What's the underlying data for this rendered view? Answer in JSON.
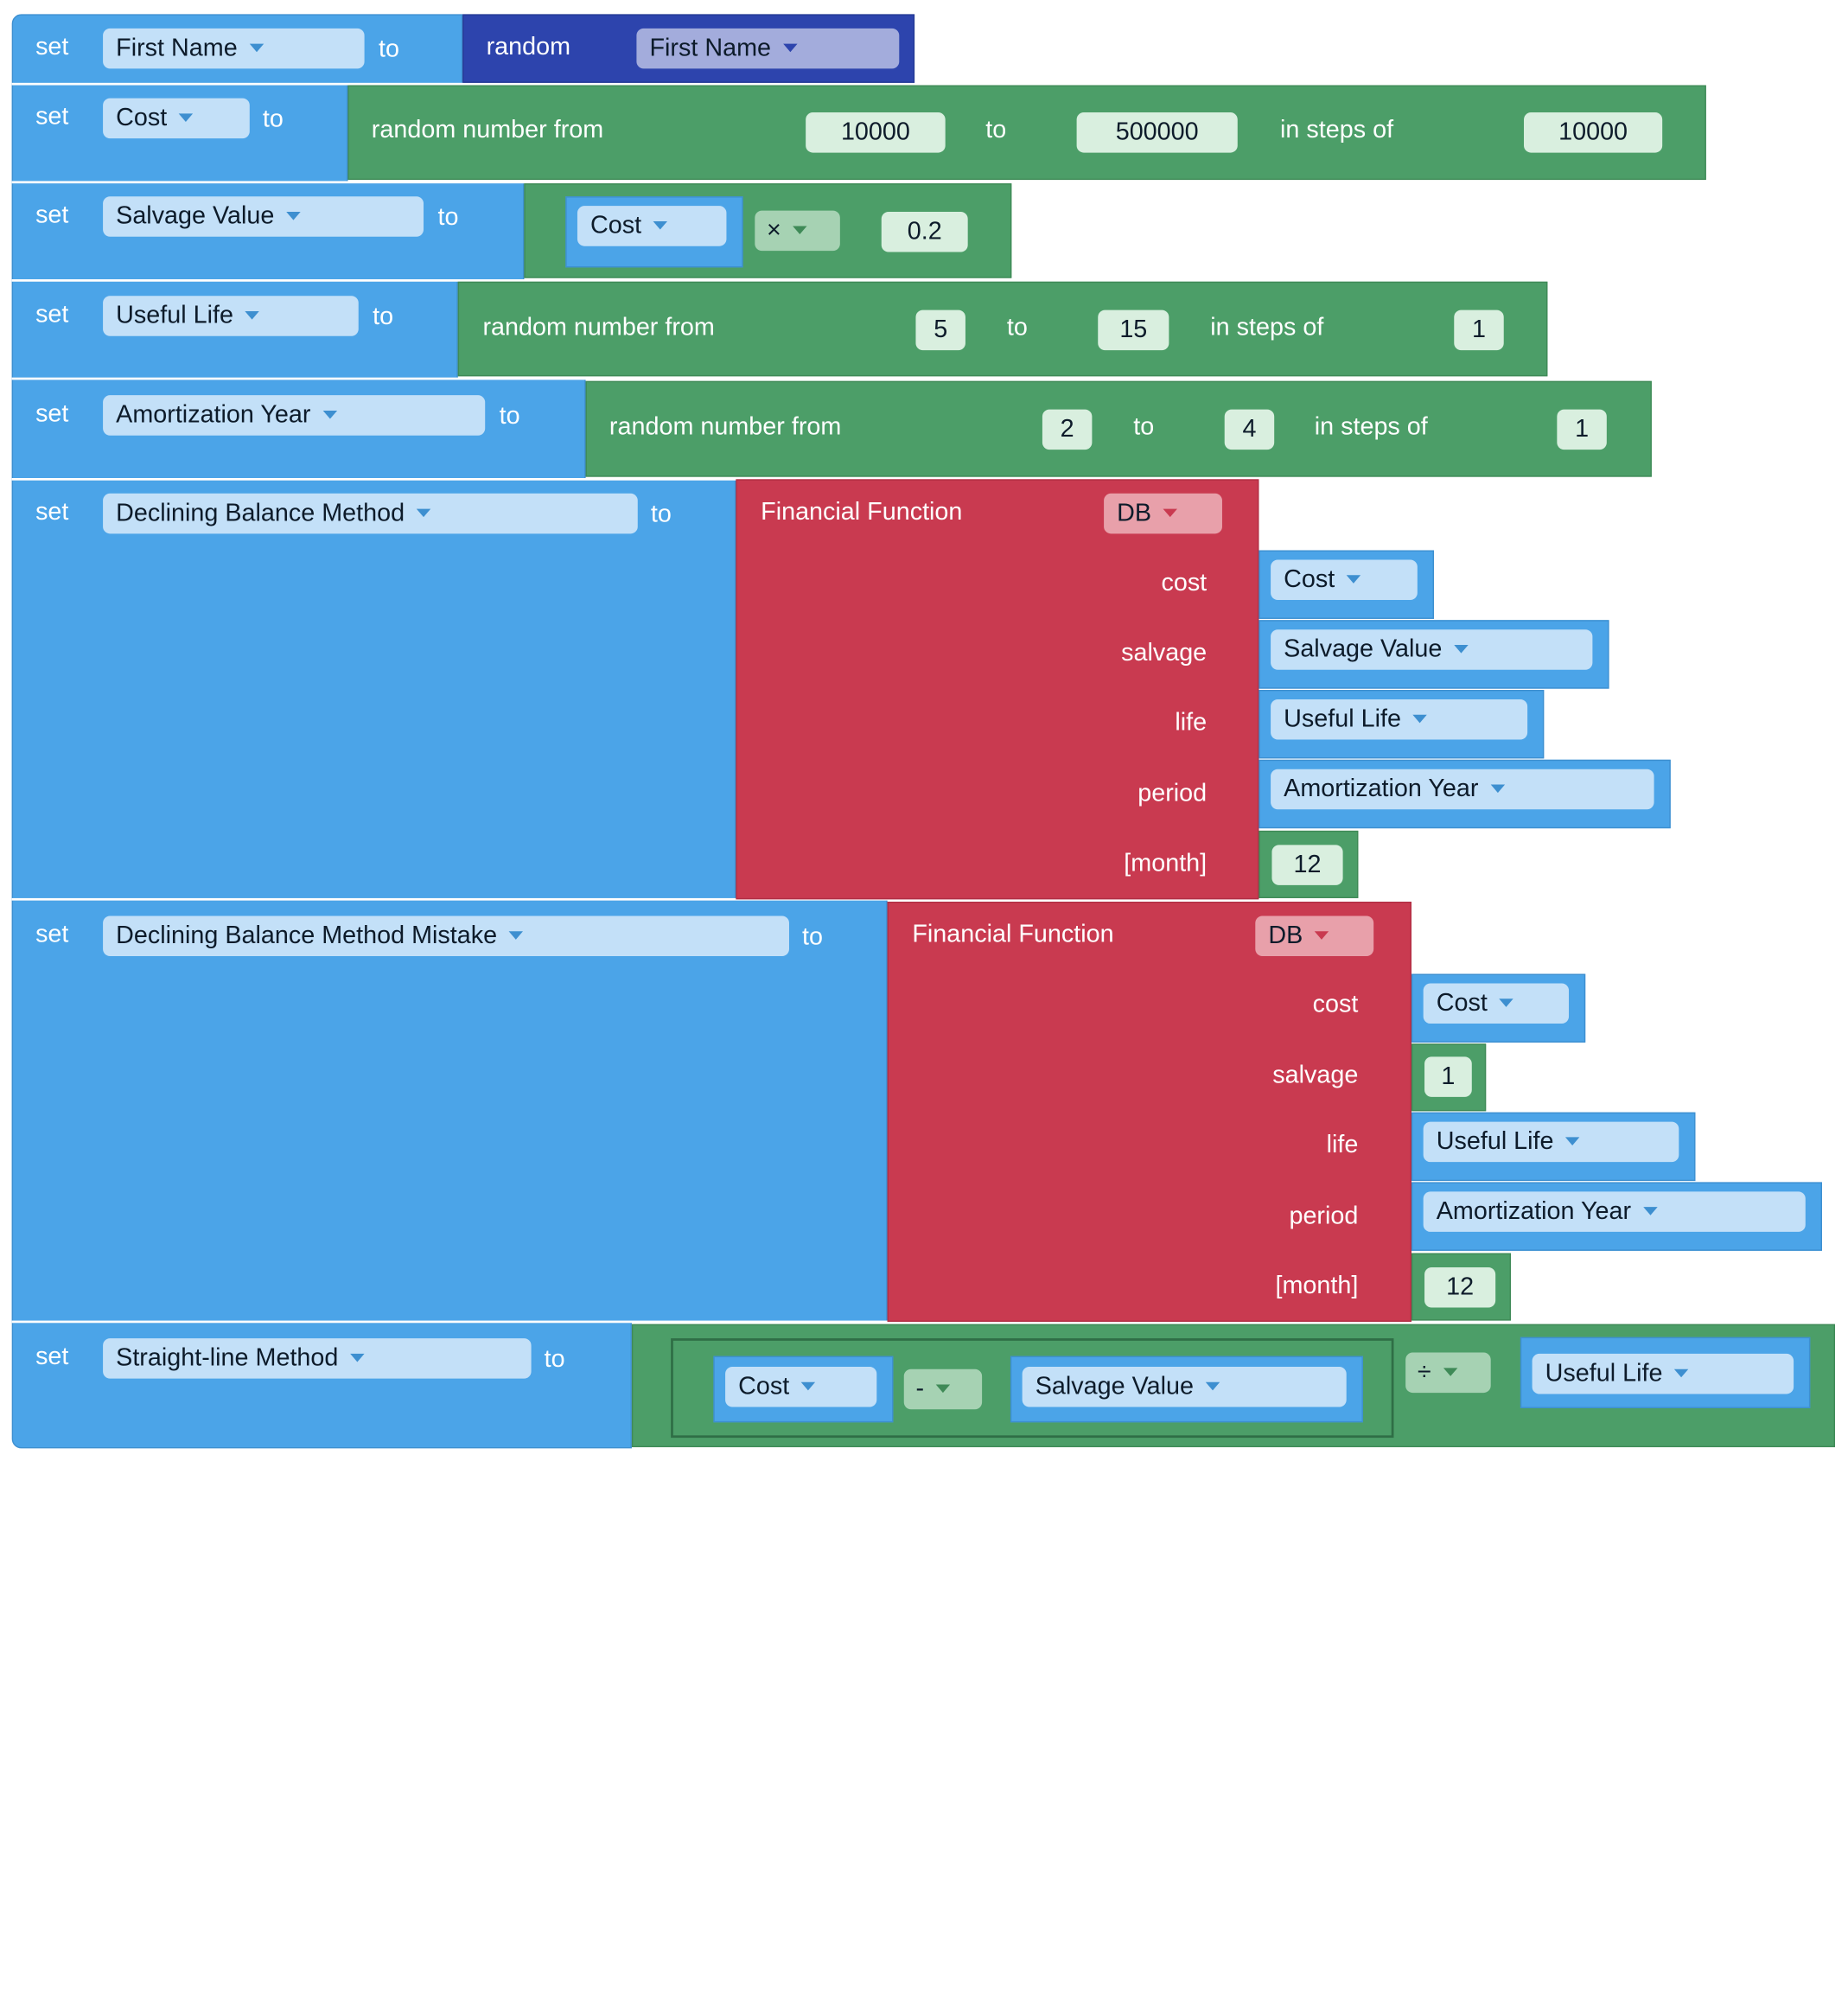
{
  "kw": {
    "set": "set",
    "to": "to",
    "random": "random",
    "random_from": "random number from",
    "steps": "in steps of",
    "financial": "Financial Function"
  },
  "rows": {
    "first_name": {
      "var": "First Name",
      "type": "First Name"
    },
    "cost": {
      "var": "Cost",
      "from": "10000",
      "to": "500000",
      "step": "10000"
    },
    "salvage": {
      "var": "Salvage Value",
      "operand": "Cost",
      "op": "×",
      "factor": "0.2"
    },
    "useful_life": {
      "var": "Useful Life",
      "from": "5",
      "to": "15",
      "step": "1"
    },
    "amort": {
      "var": "Amortization Year",
      "from": "2",
      "to": "4",
      "step": "1"
    },
    "db": {
      "var": "Declining Balance Method",
      "fn": "DB",
      "params": {
        "cost": "cost",
        "salvage": "salvage",
        "life": "life",
        "period": "period",
        "month": "[month]"
      },
      "args": {
        "cost": "Cost",
        "salvage": "Salvage Value",
        "life": "Useful Life",
        "period": "Amortization Year",
        "month": "12"
      }
    },
    "db_mistake": {
      "var": "Declining Balance Method Mistake",
      "fn": "DB",
      "params": {
        "cost": "cost",
        "salvage": "salvage",
        "life": "life",
        "period": "period",
        "month": "[month]"
      },
      "args": {
        "cost": "Cost",
        "salvage": "1",
        "life": "Useful Life",
        "period": "Amortization Year",
        "month": "12"
      }
    },
    "straight": {
      "var": "Straight-line Method",
      "a": "Cost",
      "minus": "-",
      "b": "Salvage Value",
      "div": "÷",
      "c": "Useful Life"
    }
  },
  "colors": {
    "variable": "#4ba4e8",
    "math": "#4c9e68",
    "random_type": "#2d44ad",
    "financial": "#c93a50"
  }
}
